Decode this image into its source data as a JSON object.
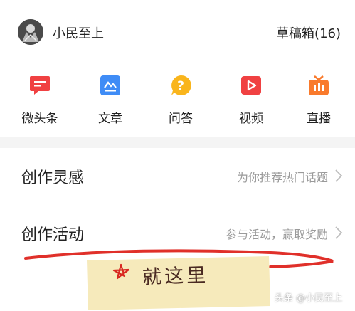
{
  "profile": {
    "username": "小民至上",
    "drafts_label": "草稿箱(16)"
  },
  "tools": [
    {
      "label": "微头条",
      "icon": "micro-headline-icon",
      "color": "#f04142"
    },
    {
      "label": "文章",
      "icon": "article-icon",
      "color": "#3f8cf6"
    },
    {
      "label": "问答",
      "icon": "qa-icon",
      "color": "#f9b51c"
    },
    {
      "label": "视频",
      "icon": "video-icon",
      "color": "#f04142"
    },
    {
      "label": "直播",
      "icon": "live-icon",
      "color": "#f97a2c"
    }
  ],
  "rows": [
    {
      "title": "创作灵感",
      "hint": "为你推荐热门话题"
    },
    {
      "title": "创作活动",
      "hint": "参与活动，赢取奖励"
    }
  ],
  "annotation": {
    "note_text": "就这里",
    "note_color": "#f6e9b8",
    "mark_color": "#e0302a"
  },
  "watermark": "头条 @小民至上"
}
